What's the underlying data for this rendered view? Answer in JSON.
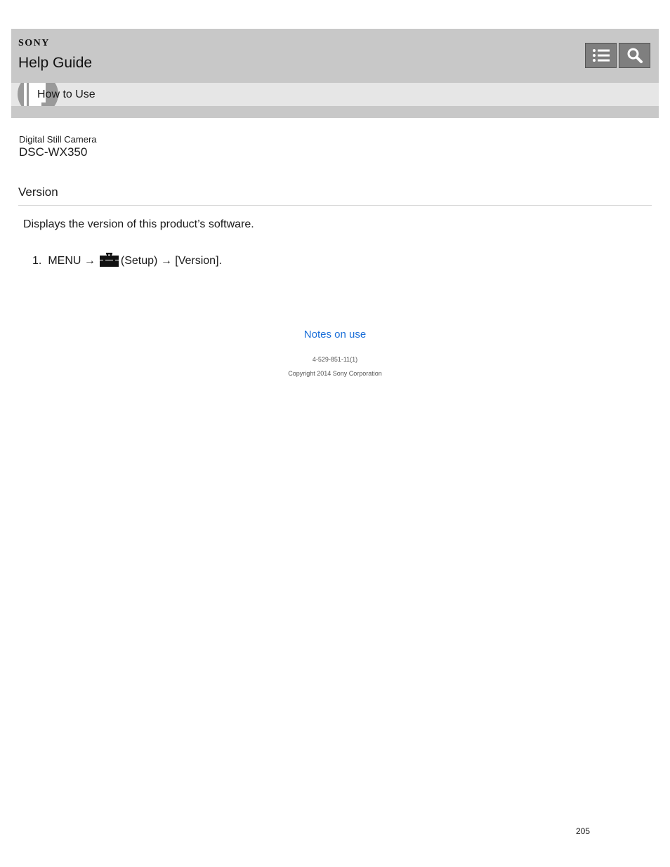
{
  "header": {
    "brand": "SONY",
    "title": "Help Guide",
    "toc_icon": "list-icon",
    "search_icon": "search-icon"
  },
  "section": {
    "label": "How to Use",
    "icon": "book-icon"
  },
  "product": {
    "type": "Digital Still Camera",
    "model": "DSC-WX350"
  },
  "page": {
    "title": "Version",
    "description": "Displays the version of this product’s software.",
    "step": {
      "number": "1.",
      "menu": "MENU →",
      "icon": "toolbox-icon",
      "rest": "(Setup) → [Version]."
    }
  },
  "footer": {
    "link": "Notes on use",
    "doc_number": "4-529-851-11(1)",
    "copyright": "Copyright 2014 Sony Corporation",
    "page_number": "205"
  },
  "colors": {
    "header_bg": "#c8c8c8",
    "section_band_bg": "#e6e6e6",
    "button_bg": "#7f7f7f",
    "link": "#1a6ed8"
  }
}
